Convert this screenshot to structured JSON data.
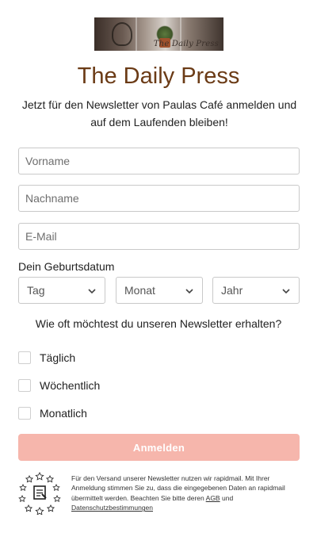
{
  "header": {
    "banner_text": "The Daily Press",
    "title": "The Daily Press",
    "subtitle": "Jetzt für den Newsletter von Paulas Café anmelden und auf dem Laufenden bleiben!"
  },
  "form": {
    "firstname_placeholder": "Vorname",
    "lastname_placeholder": "Nachname",
    "email_placeholder": "E-Mail",
    "dob_label": "Dein Geburtsdatum",
    "day_value": "Tag",
    "month_value": "Monat",
    "year_value": "Jahr",
    "frequency_question": "Wie oft möchtest du unseren Newsletter erhalten?",
    "options": [
      {
        "label": "Täglich",
        "checked": false
      },
      {
        "label": "Wöchentlich",
        "checked": false
      },
      {
        "label": "Monatlich",
        "checked": false
      }
    ],
    "submit_label": "Anmelden"
  },
  "footer": {
    "text_before": "Für den Versand unserer Newsletter nutzen wir rapidmail. Mit Ihrer Anmeldung stimmen Sie zu, dass die eingegebenen Daten an rapidmail übermittelt werden. Beachten Sie bitte deren",
    "agb_link": "AGB",
    "and_text": "und",
    "privacy_link": "Datenschutzbestimmungen"
  },
  "colors": {
    "title": "#6b3b16",
    "submit_bg": "#f6b6ac",
    "border": "#c9c9c9"
  },
  "icons": {
    "chevron": "chevron-down-icon",
    "logo": "rapidmail-logo-icon"
  }
}
